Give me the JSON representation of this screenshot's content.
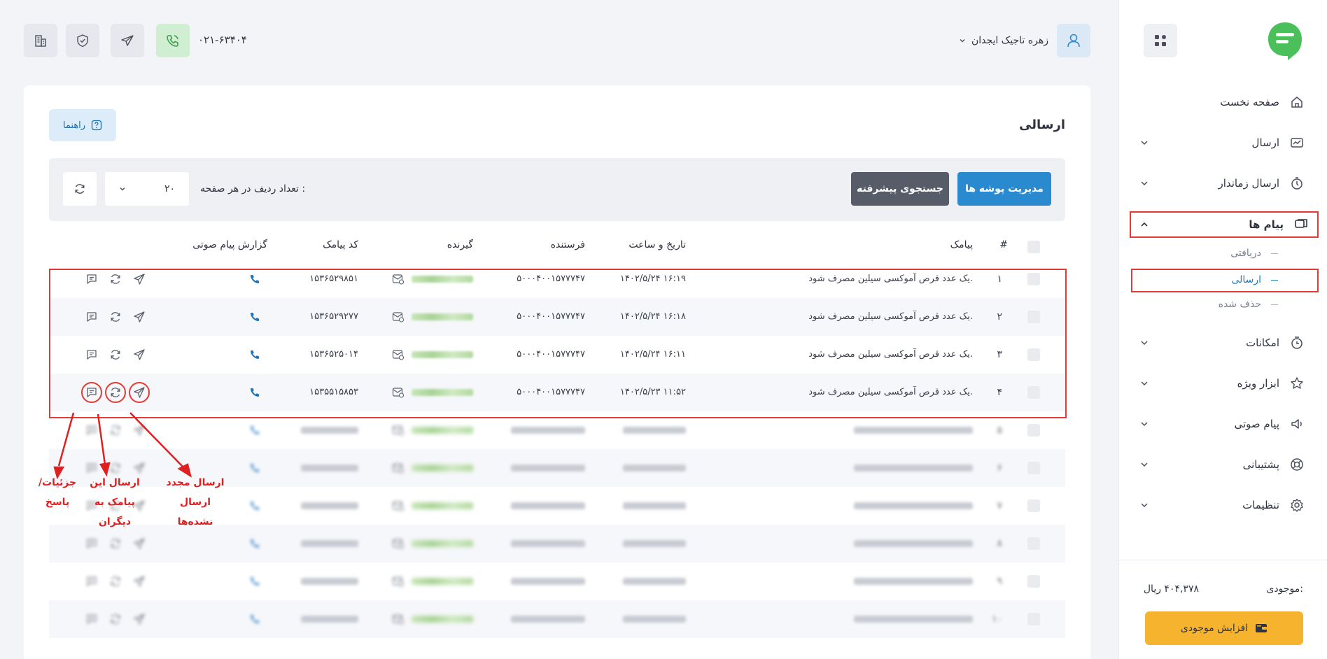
{
  "sidebar": {
    "items": [
      {
        "label": "صفحه نخست",
        "icon": "home-icon"
      },
      {
        "label": "ارسال",
        "icon": "send-sms-icon"
      },
      {
        "label": "ارسال زماندار",
        "icon": "timer-icon"
      },
      {
        "label": "پیام ها",
        "icon": "messages-icon"
      },
      {
        "label": "امکانات",
        "icon": "features-icon"
      },
      {
        "label": "ابزار ویژه",
        "icon": "star-icon"
      },
      {
        "label": "پیام صوتی",
        "icon": "speaker-icon"
      },
      {
        "label": "پشتیبانی",
        "icon": "support-icon"
      },
      {
        "label": "تنظیمات",
        "icon": "settings-icon"
      }
    ],
    "sub_items": [
      "دریافتی",
      "ارسالی",
      "حذف شده"
    ],
    "balance_label": "موجودی:",
    "balance_value": "۴۰۴,۳۷۸ ریال",
    "topup_label": "افزایش موجودی"
  },
  "header": {
    "user_name": "زهره تاجیک ایجدان",
    "phone": "۰۲۱-۶۳۴۰۴"
  },
  "page": {
    "title": "ارسالی",
    "help_label": "راهنما"
  },
  "toolbar": {
    "folders_button": "مدیریت پوشه ها",
    "advanced_search_button": "جستجوی پیشرفته",
    "rows_per_page_label": "تعداد ردیف در هر صفحه :",
    "rows_per_page_value": "۲۰"
  },
  "table": {
    "headers": {
      "index": "#",
      "message": "پیامک",
      "datetime": "تاریخ و ساعت",
      "sender": "فرستنده",
      "receiver": "گیرنده",
      "code": "کد پیامک",
      "voice_report": "گزارش پیام صوتی"
    },
    "rows": [
      {
        "index": "۱",
        "message": "یک عدد قرص آموکسی سیلین مصرف شود.",
        "datetime": "۱۴۰۲/۵/۲۴ ۱۶:۱۹",
        "sender": "۵۰۰۰۴۰۰۱۵۷۷۷۴۷",
        "code": "۱۵۳۶۵۲۹۸۵۱"
      },
      {
        "index": "۲",
        "message": "یک عدد قرص آموکسی سیلین مصرف شود.",
        "datetime": "۱۴۰۲/۵/۲۴ ۱۶:۱۸",
        "sender": "۵۰۰۰۴۰۰۱۵۷۷۷۴۷",
        "code": "۱۵۳۶۵۲۹۲۷۷"
      },
      {
        "index": "۳",
        "message": "یک عدد قرص آموکسی سیلین مصرف شود.",
        "datetime": "۱۴۰۲/۵/۲۴ ۱۶:۱۱",
        "sender": "۵۰۰۰۴۰۰۱۵۷۷۷۴۷",
        "code": "۱۵۳۶۵۲۵۰۱۴"
      },
      {
        "index": "۴",
        "message": "یک عدد قرص آموکسی سیلین مصرف شود.",
        "datetime": "۱۴۰۲/۵/۲۳ ۱۱:۵۲",
        "sender": "۵۰۰۰۴۰۰۱۵۷۷۷۴۷",
        "code": "۱۵۳۵۵۱۵۸۵۳"
      }
    ],
    "blurred_rows": [
      {
        "index": "۵"
      },
      {
        "index": "۶"
      },
      {
        "index": "۷"
      },
      {
        "index": "۸"
      },
      {
        "index": "۹"
      },
      {
        "index": "۱۰"
      }
    ]
  },
  "annotations": {
    "details": "جزئیات/ پاسخ",
    "forward": "ارسال این پیامک به دیگران",
    "resend": "ارسال مجدد ارسال نشده‌ها"
  },
  "colors": {
    "accent_blue": "#2a8ad0",
    "dark_button": "#565d69",
    "topup_yellow": "#f6b42e",
    "annotation_red": "#e53935",
    "phone_green_bg": "#cfeed2"
  }
}
